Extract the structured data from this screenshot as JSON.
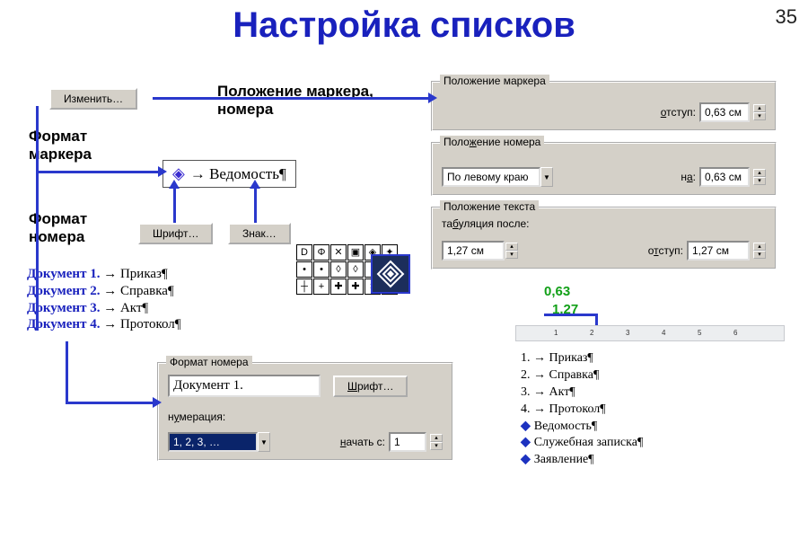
{
  "meta": {
    "slide_number": "35"
  },
  "title": "Настройка списков",
  "labels": {
    "position_marker_number": "Положение маркера, номера",
    "format_marker": "Формат маркера",
    "format_number": "Формат номера",
    "btn_change": "Изменить…",
    "btn_font": "Шрифт…",
    "btn_symbol": "Знак…"
  },
  "sample": {
    "text": "→ Ведомость¶"
  },
  "doclist": [
    {
      "label": "Документ 1.",
      "text": " → Приказ¶"
    },
    {
      "label": "Документ 2.",
      "text": " → Справка¶"
    },
    {
      "label": "Документ 3.",
      "text": " → Акт¶"
    },
    {
      "label": "Документ 4.",
      "text": " → Протокол¶"
    }
  ],
  "panel_marker_pos": {
    "legend": "Положение маркера",
    "indent_label": "отступ:",
    "indent_value": "0,63 см"
  },
  "panel_number_pos": {
    "legend": "Положение номера",
    "align_value": "По левому краю",
    "at_label": "на:",
    "at_value": "0,63 см"
  },
  "panel_text_pos": {
    "legend": "Положение текста",
    "tab_label": "табуляция после:",
    "tab_value": "1,27 см",
    "indent_label": "отступ:",
    "indent_value": "1,27 см"
  },
  "panel_format_number": {
    "legend": "Формат номера",
    "format_value": "Документ 1.",
    "btn_font": "Шрифт…",
    "numbering_label": "нумерация:",
    "numbering_value": "1, 2, 3, …",
    "start_label": "начать с:",
    "start_value": "1"
  },
  "ruler_marks": {
    "val1": "0,63",
    "val2": "1,27"
  },
  "right_list": [
    "1. → Приказ¶",
    "2. → Справка¶",
    "3. → Акт¶",
    "4. → Протокол¶",
    "Ведомость¶",
    "Служебная записка¶",
    "Заявление¶"
  ]
}
